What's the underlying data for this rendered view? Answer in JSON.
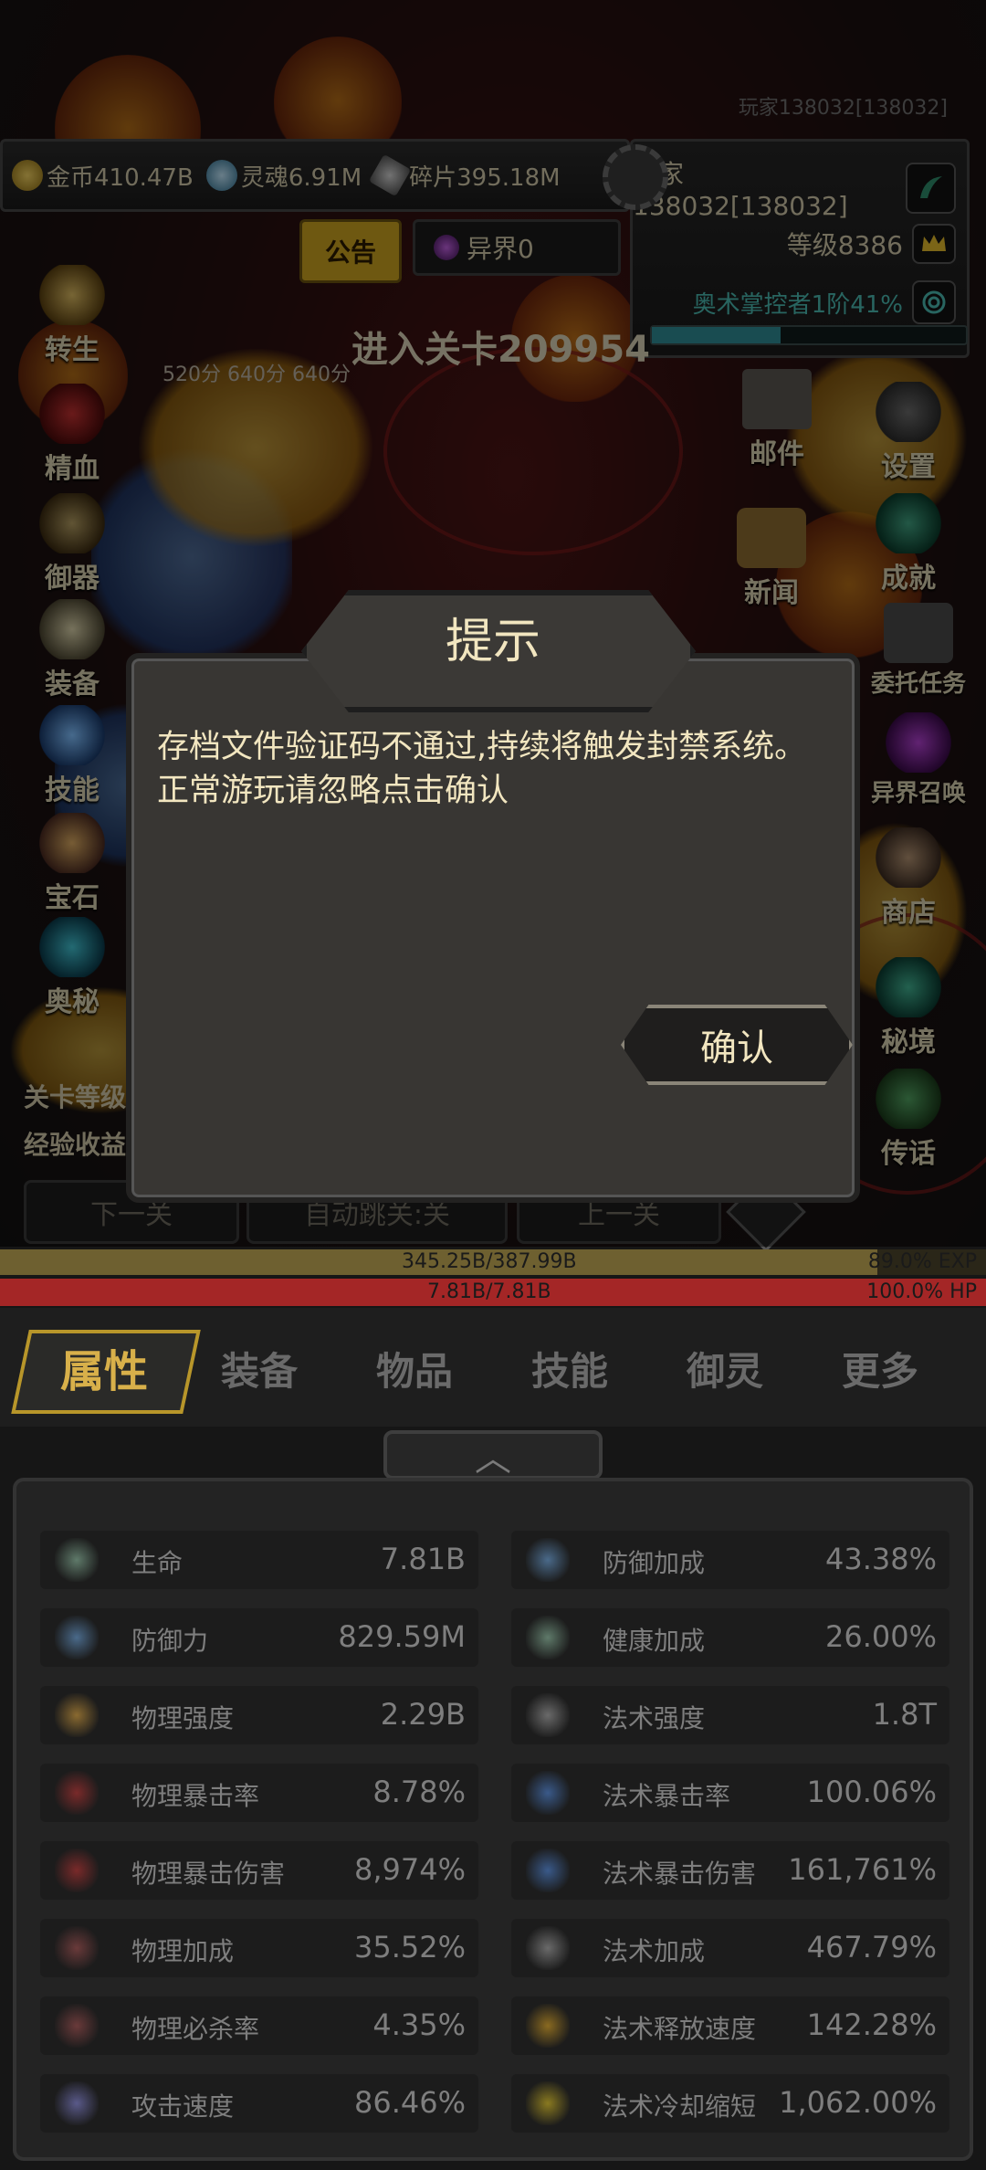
{
  "header": {
    "player_id_top": "玩家138032[138032]",
    "resources": [
      {
        "label": "金币410.47B",
        "icon": "coin-icon",
        "color": "#c8a840"
      },
      {
        "label": "灵魂6.91M",
        "icon": "soul-icon",
        "color": "#7fb6d8"
      },
      {
        "label": "碎片395.18M",
        "icon": "shard-icon",
        "color": "#9a9a9a"
      }
    ],
    "player_name": "玩家138032[138032]",
    "level": "等级8386",
    "notice": "公告",
    "otherworld": "异界0",
    "mastery": "奥术掌控者1阶41%",
    "mastery_fraction": 0.41,
    "stage_enter": "进入关卡209954",
    "scores": "520分  640分  640分"
  },
  "left_menu": [
    {
      "label": "转生",
      "icon": "rebirth-icon"
    },
    {
      "label": "精血",
      "icon": "blood-icon"
    },
    {
      "label": "御器",
      "icon": "artifact-icon"
    },
    {
      "label": "装备",
      "icon": "equipment-icon"
    },
    {
      "label": "技能",
      "icon": "skill-icon"
    },
    {
      "label": "宝石",
      "icon": "gem-icon"
    },
    {
      "label": "奥秘",
      "icon": "arcane-icon"
    }
  ],
  "right_menu": [
    {
      "label": "邮件",
      "icon": "mail-icon"
    },
    {
      "label": "设置",
      "icon": "settings-icon"
    },
    {
      "label": "新闻",
      "icon": "news-icon"
    },
    {
      "label": "成就",
      "icon": "achievement-icon"
    },
    {
      "label": "委托任务",
      "icon": "quest-icon"
    },
    {
      "label": "异界召唤",
      "icon": "summon-icon"
    },
    {
      "label": "商店",
      "icon": "shop-icon"
    },
    {
      "label": "秘境",
      "icon": "secret-realm-icon"
    },
    {
      "label": "传话",
      "icon": "message-icon"
    }
  ],
  "stage_info": {
    "level": "关卡等级",
    "exp": "经验收益"
  },
  "stage_nav": {
    "next": "下一关",
    "auto": "自动跳关:关",
    "prev": "上一关"
  },
  "modal": {
    "title": "提示",
    "message": "存档文件验证码不通过,持续将触发封禁系统。正常游玩请忽略点击确认",
    "confirm": "确认"
  },
  "bars": {
    "exp_text": "345.25B/387.99B",
    "exp_pct": "89.0% EXP",
    "exp_fraction": 0.89,
    "hp_text": "7.81B/7.81B",
    "hp_pct": "100.0%  HP",
    "hp_fraction": 1.0
  },
  "tabs": [
    "属性",
    "装备",
    "物品",
    "技能",
    "御灵",
    "更多"
  ],
  "collapse_symbol": "︿",
  "stats_left": [
    {
      "label": "生命",
      "value": "7.81B",
      "icon": "health-cross-icon",
      "color": "#5f7a6a"
    },
    {
      "label": "防御力",
      "value": "829.59M",
      "icon": "shield-icon",
      "color": "#4a6a8a"
    },
    {
      "label": "物理强度",
      "value": "2.29B",
      "icon": "sword-icon",
      "color": "#8a6a30"
    },
    {
      "label": "物理暴击率",
      "value": "8.78%",
      "icon": "phys-crit-icon",
      "color": "#7a2a2a"
    },
    {
      "label": "物理暴击伤害",
      "value": "8,974%",
      "icon": "phys-crit-damage-icon",
      "color": "#7a2a2a"
    },
    {
      "label": "物理加成",
      "value": "35.52%",
      "icon": "phys-bonus-icon",
      "color": "#6a3a3a"
    },
    {
      "label": "物理必杀率",
      "value": "4.35%",
      "icon": "phys-lethal-icon",
      "color": "#6a3a3a"
    },
    {
      "label": "攻击速度",
      "value": "86.46%",
      "icon": "attack-speed-icon",
      "color": "#5a5a8a"
    }
  ],
  "stats_right": [
    {
      "label": "防御加成",
      "value": "43.38%",
      "icon": "shield-bonus-icon",
      "color": "#4a6a8a"
    },
    {
      "label": "健康加成",
      "value": "26.00%",
      "icon": "health-bonus-icon",
      "color": "#5f7a6a"
    },
    {
      "label": "法术强度",
      "value": "1.8T",
      "icon": "spell-power-icon",
      "color": "#6a6a6a"
    },
    {
      "label": "法术暴击率",
      "value": "100.06%",
      "icon": "spell-crit-icon",
      "color": "#3a5a8a"
    },
    {
      "label": "法术暴击伤害",
      "value": "161,761%",
      "icon": "spell-crit-damage-icon",
      "color": "#3a5a8a"
    },
    {
      "label": "法术加成",
      "value": "467.79%",
      "icon": "spell-bonus-icon",
      "color": "#6a6a6a"
    },
    {
      "label": "法术释放速度",
      "value": "142.28%",
      "icon": "cast-speed-icon",
      "color": "#8a6a20"
    },
    {
      "label": "法术冷却缩短",
      "value": "1,062.00%",
      "icon": "cooldown-icon",
      "color": "#8a7a20"
    }
  ]
}
